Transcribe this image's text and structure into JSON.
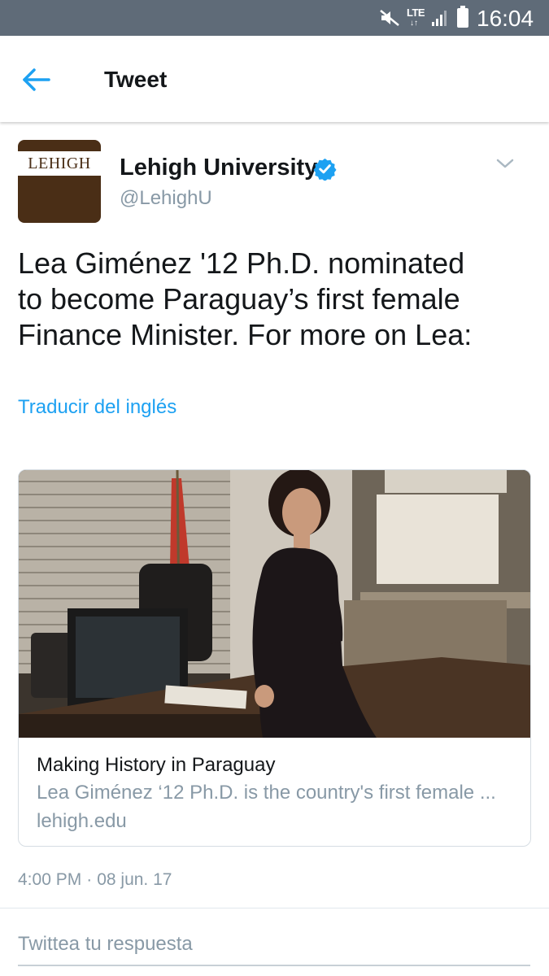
{
  "status_bar": {
    "network": "LTE",
    "network_arrows": "↓↑",
    "time": "16:04",
    "icons": [
      "mute-icon",
      "signal-icon",
      "battery-icon"
    ]
  },
  "header": {
    "title": "Tweet",
    "back_icon": "arrow-left-icon",
    "accent_color": "#1da1f2"
  },
  "tweet": {
    "avatar_logo_text": "LEHIGH",
    "display_name": "Lehigh University",
    "verified": true,
    "handle": "@LehighU",
    "text_lines": [
      "Lea Giménez '12 Ph.D. nominated",
      "to become Paraguay’s first female",
      "Finance Minister. For more on Lea:"
    ],
    "translate_label": "Traducir del inglés",
    "card": {
      "title": "Making History in Paraguay",
      "description": "Lea Giménez ‘12 Ph.D. is the country's first female ...",
      "domain": "lehigh.edu"
    },
    "time": "4:00 PM",
    "separator": "·",
    "date": "08 jun. 17"
  },
  "reply": {
    "placeholder": "Twittea tu respuesta"
  }
}
